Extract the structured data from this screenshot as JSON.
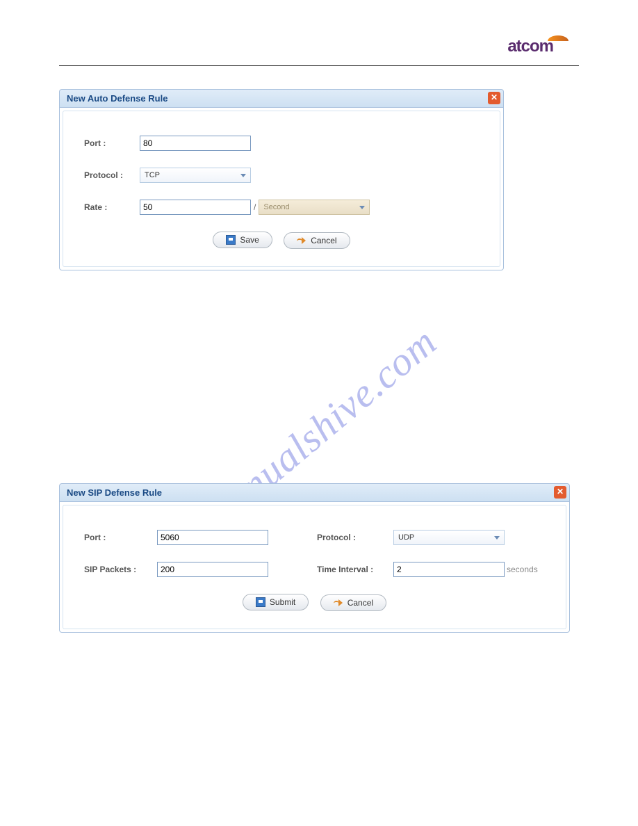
{
  "brand": "atcom",
  "panel1": {
    "title": "New Auto Defense Rule",
    "port_label": "Port :",
    "port_value": "80",
    "protocol_label": "Protocol :",
    "protocol_value": "TCP",
    "rate_label": "Rate :",
    "rate_value": "50",
    "rate_unit": "Second",
    "save_label": "Save",
    "cancel_label": "Cancel"
  },
  "panel2": {
    "title": "New SIP Defense Rule",
    "port_label": "Port :",
    "port_value": "5060",
    "protocol_label": "Protocol :",
    "protocol_value": "UDP",
    "packets_label": "SIP Packets :",
    "packets_value": "200",
    "interval_label": "Time Interval :",
    "interval_value": "2",
    "interval_suffix": "seconds",
    "submit_label": "Submit",
    "cancel_label": "Cancel"
  },
  "watermark": "manualshive.com"
}
